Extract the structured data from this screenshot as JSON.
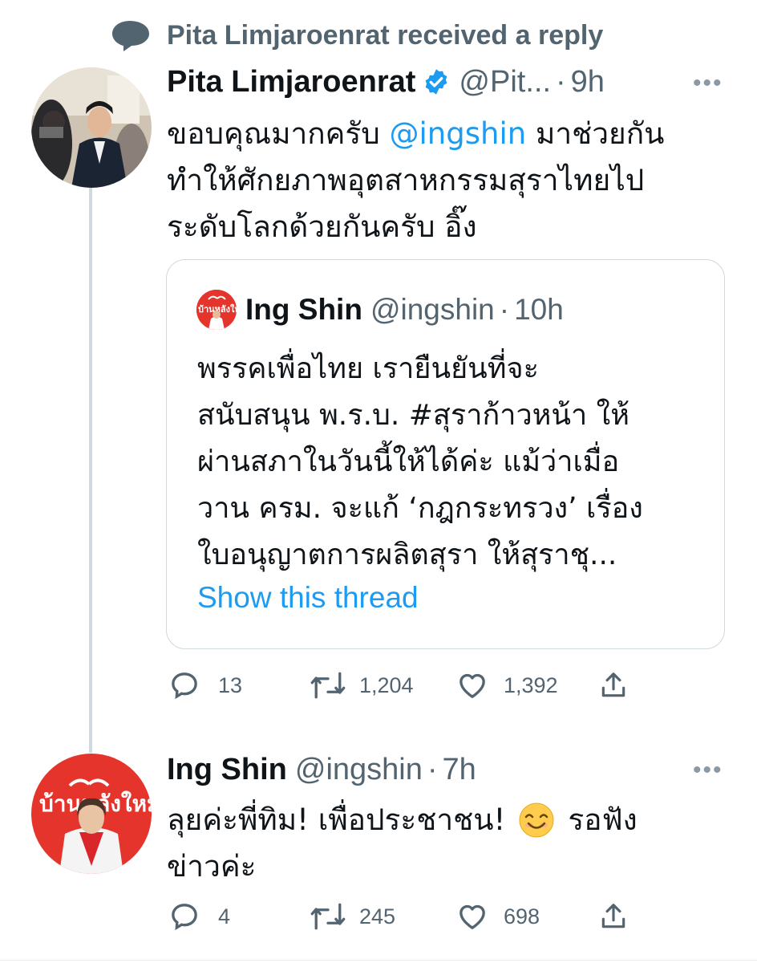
{
  "social_context": {
    "text": "Pita Limjaroenrat received a reply",
    "icon": "speech-bubble-icon"
  },
  "tweet1": {
    "author_name": "Pita Limjaroenrat",
    "handle": "@Pit...",
    "time": "9h",
    "verified": true,
    "text_before_mention": "ขอบคุณมากครับ ",
    "mention": "@ingshin",
    "text_after_mention": " มาช่วยกัน",
    "text_line2": "ทำให้ศักยภาพอุตสาหกรรมสุราไทยไป",
    "text_line3": "ระดับโลกด้วยกันครับ อิ๊ง",
    "quote": {
      "author_name": "Ing Shin",
      "handle": "@ingshin",
      "time": "10h",
      "avatar_logo_text": "บ้านหลังใหม่",
      "lines": [
        "พรรคเพื่อไทย เรายืนยันที่จะ",
        "สนับสนุน  พ.ร.บ. #สุราก้าวหน้า ให้",
        "ผ่านสภาในวันนี้ให้ได้ค่ะ แม้ว่าเมื่อ",
        "วาน ครม. จะแก้ ‘กฎกระทรวง’ เรื่อง",
        "ใบอนุญาตการผลิตสุรา ให้สุราชุ..."
      ],
      "show_thread": "Show this thread"
    },
    "replies": "13",
    "retweets": "1,204",
    "likes": "1,392"
  },
  "tweet2": {
    "author_name": "Ing Shin",
    "handle": "@ingshin",
    "time": "7h",
    "avatar_logo_text": "บ้านหลังใหม่",
    "text_line1": "ลุยค่ะพี่ทิม! เพื่อประชาชน!",
    "emoji": "smiling-face-icon",
    "text_line1_end": "รอฟัง",
    "text_line2": "ข่าวค่ะ",
    "replies": "4",
    "retweets": "245",
    "likes": "698"
  },
  "colors": {
    "accent": "#1d9bf0",
    "text": "#0f1419",
    "secondary": "#536471",
    "border": "#cfd9de",
    "brand_red": "#e4342b"
  }
}
